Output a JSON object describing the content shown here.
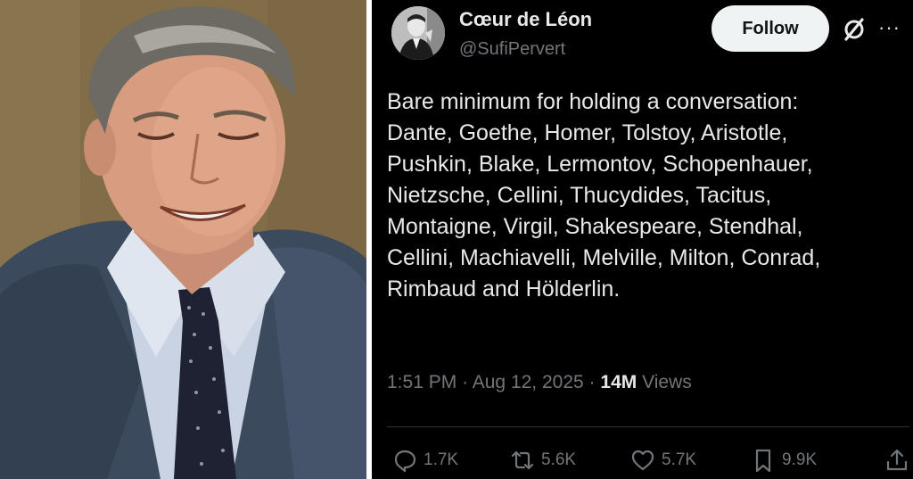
{
  "author": {
    "display_name": "Cœur de Léon",
    "handle": "@SufiPervert"
  },
  "buttons": {
    "follow_label": "Follow",
    "more_label": "···"
  },
  "tweet": {
    "lines": [
      "Bare minimum for holding a conversation:",
      "Dante, Goethe, Homer, Tolstoy, Aristotle,",
      "Pushkin, Blake, Lermontov, Schopenhauer,",
      "Nietzsche, Cellini, Thucydides, Tacitus,",
      "Montaigne, Virgil, Shakespeare, Stendhal,",
      "Cellini, Machiavelli, Melville, Milton, Conrad,",
      "Rimbaud and Hölderlin."
    ],
    "time": "1:51 PM",
    "date": "Aug 12, 2025",
    "separator": "·",
    "views_count": "14M",
    "views_label": "Views"
  },
  "actions": {
    "replies": "1.7K",
    "reposts": "5.6K",
    "likes": "5.7K",
    "bookmarks": "9.9K"
  },
  "icons": [
    "grok-icon",
    "more-icon",
    "reply-icon",
    "repost-icon",
    "like-icon",
    "bookmark-icon",
    "share-icon"
  ],
  "colors": {
    "background": "#000000",
    "primary_text": "#e7e9ea",
    "secondary_text": "#71767b",
    "follow_button": "#eff3f4"
  }
}
